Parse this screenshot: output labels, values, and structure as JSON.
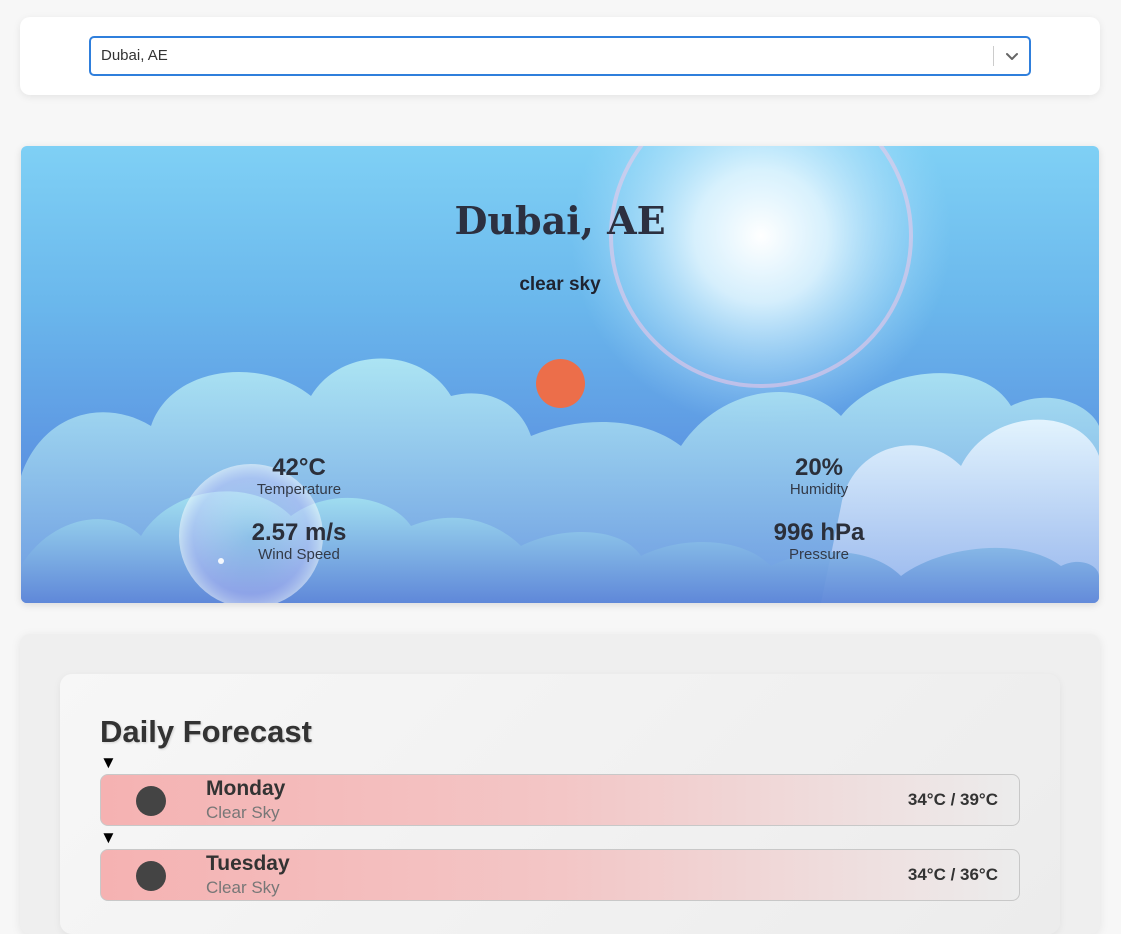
{
  "search": {
    "selected_city": "Dubai, AE"
  },
  "current": {
    "city": "Dubai, AE",
    "description": "clear sky",
    "icon": "sun-icon",
    "stats": {
      "temperature": {
        "value": "42°C",
        "label": "Temperature"
      },
      "humidity": {
        "value": "20%",
        "label": "Humidity"
      },
      "wind": {
        "value": "2.57 m/s",
        "label": "Wind Speed"
      },
      "pressure": {
        "value": "996 hPa",
        "label": "Pressure"
      }
    }
  },
  "forecast": {
    "title": "Daily Forecast",
    "toggle_glyph": "▼",
    "days": [
      {
        "day": "Monday",
        "condition": "Clear Sky",
        "temp_range": "34°C / 39°C"
      },
      {
        "day": "Tuesday",
        "condition": "Clear Sky",
        "temp_range": "34°C / 36°C"
      }
    ]
  },
  "colors": {
    "accent": "#2f7fdc",
    "sun_icon": "#ec6e4a",
    "row_gradient_start": "#f5b2b2"
  }
}
